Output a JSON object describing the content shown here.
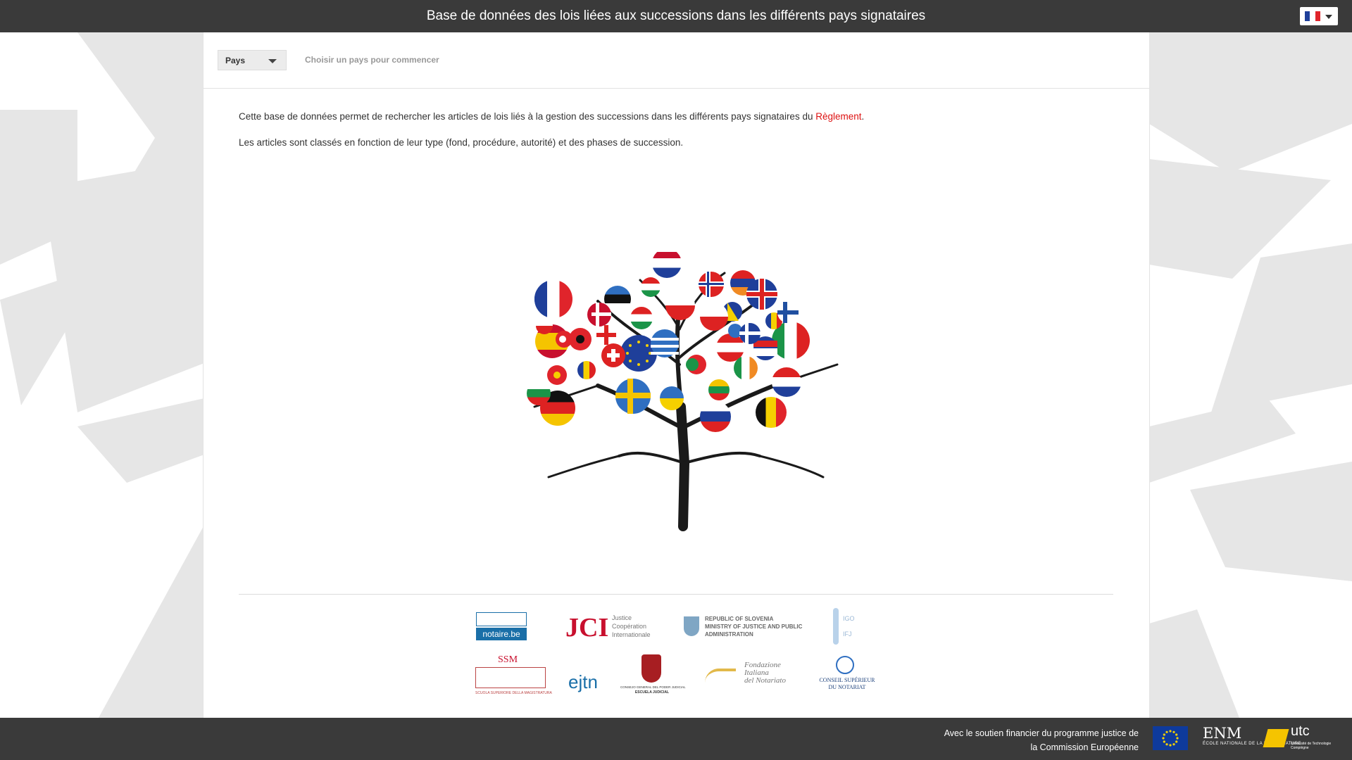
{
  "header": {
    "title": "Base de données des lois liées aux successions dans les différents pays signataires",
    "language_flag": "flag-france-icon"
  },
  "country_selector": {
    "label": "Pays",
    "hint": "Choisir un pays pour commencer"
  },
  "intro": {
    "paragraph1_prefix": "Cette base de données permet de rechercher les articles de lois liés à la gestion des successions dans les différents pays signataires du ",
    "paragraph1_link": "Règlement",
    "paragraph1_suffix": ".",
    "paragraph2": "Les articles sont classés en fonction de leur type (fond, procédure, autorité) et des phases de succession."
  },
  "partners": {
    "notaire": "notaire.be",
    "jci_line1": "Justice",
    "jci_line2": "Coopération",
    "jci_line3": "Internationale",
    "slovenia_line1": "REPUBLIC OF SLOVENIA",
    "slovenia_line2": "MINISTRY OF JUSTICE AND PUBLIC",
    "slovenia_line3": "ADMINISTRATION",
    "igo": "IGO",
    "ifj": "IFJ",
    "ssm": "SSM",
    "ssm_sub": "SCUOLA SUPERIORE DELLA MAGISTRATURA",
    "ejtn": "ejtn",
    "cgpj": "CONSEJO GENERAL DEL PODER JUDICIAL",
    "cgpj_sub": "ESCUELA JUDICIAL",
    "fondazione_line1": "Fondazione",
    "fondazione_line2": "Italiana",
    "fondazione_line3": "del Notariato",
    "csn_line1": "CONSEIL SUPÉRIEUR",
    "csn_line2": "DU NOTARIAT"
  },
  "footer": {
    "support_line1": "Avec le soutien financier du programme justice de",
    "support_line2": "la Commission Européenne",
    "enm": "ENM",
    "enm_sub": "ÉCOLE NATIONALE DE LA MAGISTRATURE",
    "utc": "utc",
    "utc_sub": "Université de Technologie Compiègne"
  },
  "colors": {
    "header_bg": "#3a3a3a",
    "footer_bg": "#3a3a3a",
    "link": "#dd1111",
    "background_shapes": "#e6e6e6"
  }
}
